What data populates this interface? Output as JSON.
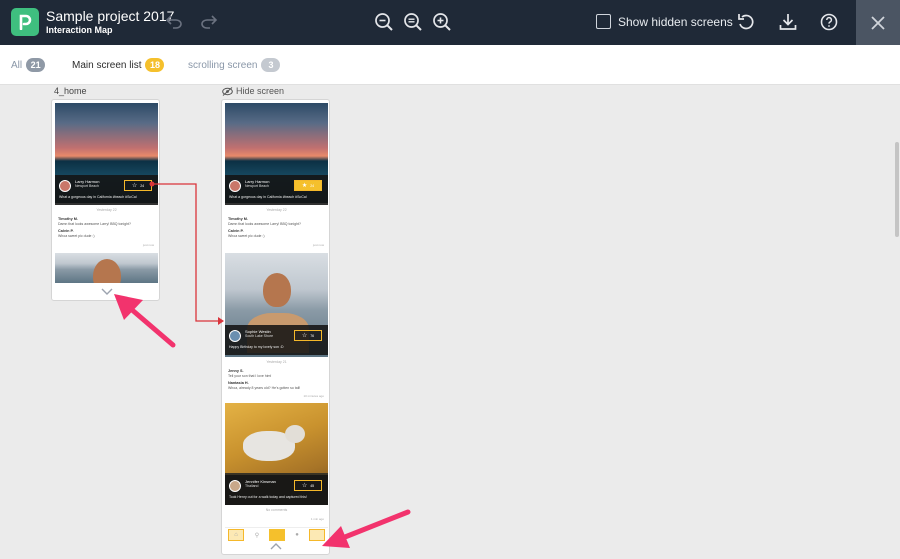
{
  "header": {
    "project_title": "Sample project 2017",
    "subtitle": "Interaction Map",
    "show_hidden_label": "Show hidden screens"
  },
  "filters": {
    "all": {
      "label": "All",
      "count": "21"
    },
    "main": {
      "label": "Main screen list",
      "count": "18"
    },
    "scrolling": {
      "label": "scrolling screen",
      "count": "3"
    }
  },
  "screens": {
    "first": {
      "name": "4_home"
    },
    "second": {
      "hide_label": "Hide screen"
    }
  },
  "feed": {
    "post1": {
      "name": "Larry Harmon",
      "location": "Newport Beach",
      "caption": "What a gorgeous day in California #beach #SoCal",
      "likes": "24"
    },
    "date1": "Yesterday 22",
    "comment1": {
      "name": "Timothy M.",
      "text": "Damn that looks awesome Larry! BBQ tonight?"
    },
    "comment2": {
      "name": "Calvin P.",
      "text": "Whoa sweet pic dude :)"
    },
    "time1": "just now",
    "post2": {
      "name": "Sophie Westin",
      "location": "South Lake Shore",
      "caption": "Happy Birthday to my lovely son :D",
      "likes": "76"
    },
    "date2": "Yesterday 21",
    "comment3": {
      "name": "Jenny S.",
      "text": "Tell your son that I love him!"
    },
    "comment4": {
      "name": "Nantasia H.",
      "text": "Whoa, already 8 years old? He's gotten so tall!"
    },
    "time2": "10 minutes ago",
    "post3": {
      "name": "Jennifer Kinsman",
      "location": "Thailand",
      "caption": "Took Henry out for a walk today and captured this!",
      "likes": "45"
    },
    "date3": "No comments",
    "time3": "1 min ago"
  },
  "colors": {
    "accent": "#f5c02c",
    "connector": "#d9343b",
    "annotation": "#f2336d",
    "topbar": "#1f2937"
  }
}
